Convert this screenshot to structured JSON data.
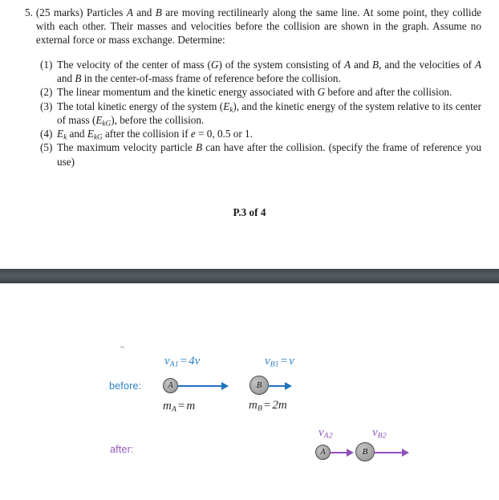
{
  "question": {
    "number": "5.",
    "marks_label": "(25 marks)",
    "intro_html": "(25 marks) Particles <i>A</i> and <i>B</i> are moving rectilinearly along the same line. At some point, they collide with each other. Their masses and velocities before the collision are shown in the graph. Assume no external force or mass exchange. Determine:",
    "intro_plain": "(25 marks) Particles A and B are moving rectilinearly along the same line. At some point, they collide with each other. Their masses and velocities before the collision are shown in the graph. Assume no external force or mass exchange. Determine:",
    "sub_items": [
      {
        "marker": "(1)",
        "html": "The velocity of the center of mass (<i>G</i>) of the system consisting of <i>A</i> and <i>B</i>, and the velocities of <i>A</i> and <i>B</i> in the center-of-mass frame of reference before the collision.",
        "plain": "The velocity of the center of mass (G) of the system consisting of A and B, and the velocities of A and B in the center-of-mass frame of reference before the collision."
      },
      {
        "marker": "(2)",
        "html": "The linear momentum and the kinetic energy associated with <i>G</i> before and after the collision.",
        "plain": "The linear momentum and the kinetic energy associated with G before and after the collision."
      },
      {
        "marker": "(3)",
        "html": "The total kinetic energy of the system (<i>E</i><sub class=\"sb\">k</sub>), and the kinetic energy of the system relative to its center of mass (<i>E</i><sub class=\"sb\">kG</sub>), before the collision.",
        "plain": "The total kinetic energy of the system (Ek), and the kinetic energy of the system relative to its center of mass (EkG), before the collision."
      },
      {
        "marker": "(4)",
        "html": "<i>E</i><sub class=\"sb\">k</sub> and <i>E</i><sub class=\"sb\">kG</sub> after the collision if <i>e</i> = 0, 0.5 or 1.",
        "plain": "Ek and EkG after the collision if e = 0, 0.5 or 1."
      },
      {
        "marker": "(5)",
        "html": "The maximum velocity particle <i>B</i> can have after the collision. (specify the frame of reference you use)",
        "plain": "The maximum velocity particle B can have after the collision. (specify the frame of reference you use)"
      }
    ]
  },
  "footer": {
    "page_marker": "P.3 of 4"
  },
  "diagram": {
    "rows": {
      "before": {
        "label": "before:",
        "color": "#2a7fc9"
      },
      "after": {
        "label": "after:",
        "color": "#9457c0"
      }
    },
    "before_particles": [
      {
        "id": "A",
        "letter": "A",
        "velocity_html": "<i>v</i><sub>A1</sub><span class=\"eq\">=</span>4<i>v</i>",
        "velocity_plain": "v_A1 = 4v",
        "mass_html": "<i>m</i><sub>A</sub><span class=\"eq\">=</span><i>m</i>",
        "mass_plain": "m_A = m"
      },
      {
        "id": "B",
        "letter": "B",
        "velocity_html": "<i>v</i><sub>B1</sub><span class=\"eq\">=</span><i>v</i>",
        "velocity_plain": "v_B1 = v",
        "mass_html": "<i>m</i><sub>B</sub><span class=\"eq\">=</span>2<i>m</i>",
        "mass_plain": "m_B = 2m"
      }
    ],
    "after_particles": [
      {
        "id": "A",
        "letter": "A",
        "velocity_html": "<i>v</i><sub>A2</sub>",
        "velocity_plain": "v_A2"
      },
      {
        "id": "B",
        "letter": "B",
        "velocity_html": "<i>v</i><sub>B2</sub>",
        "velocity_plain": "v_B2"
      }
    ]
  },
  "colors": {
    "before_accent": "#2a7fc9",
    "after_accent": "#9457c0",
    "band": "#4c5459",
    "particle_fill": "#a9a9a9",
    "text": "#1a1a1a"
  }
}
